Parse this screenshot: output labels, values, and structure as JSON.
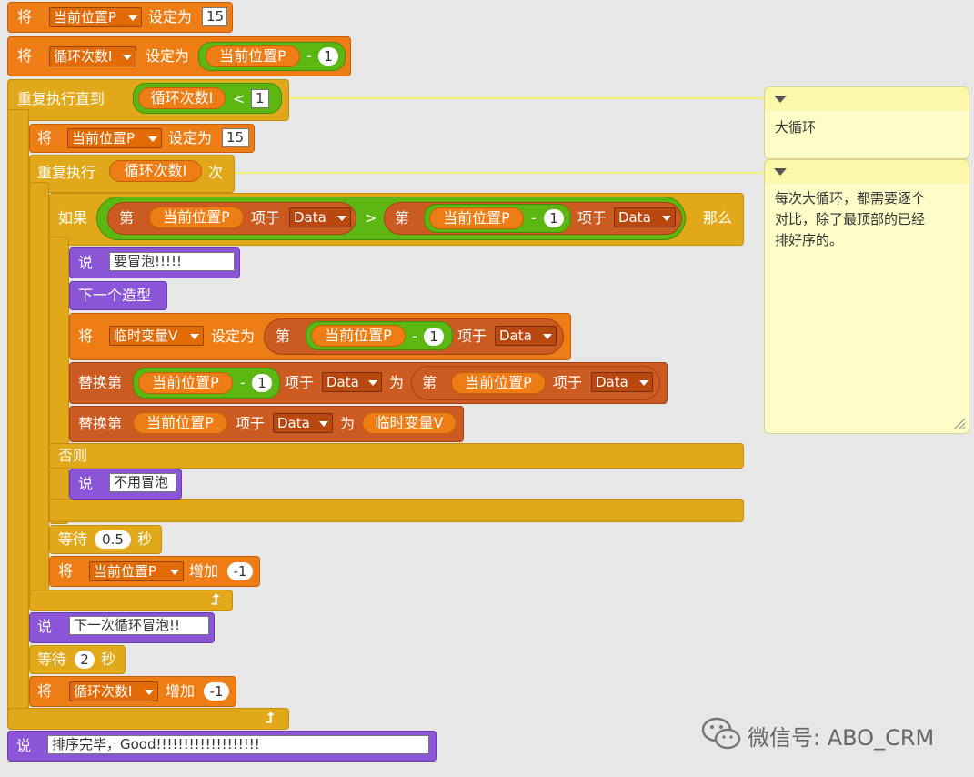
{
  "k": {
    "jiang": "将",
    "set_to": "设定为",
    "repeat_until": "重复执行直到",
    "repeat": "重复执行",
    "times": "次",
    "if": "如果",
    "else": "否则",
    "then": "那么",
    "say": "说",
    "next_costume": "下一个造型",
    "wait": "等待",
    "seconds": "秒",
    "change_by": "增加",
    "item": "第",
    "of": "项于",
    "replace_item": "替换第",
    "with": "为",
    "lt": "<",
    "gt": ">",
    "minus": "-"
  },
  "vars": {
    "pos": "当前位置P",
    "loop": "循环次数I",
    "temp": "临时变量V",
    "list": "Data"
  },
  "vals": {
    "set_pos": "15",
    "one": "1",
    "lt_val": "1",
    "inner_set_pos": "15",
    "wait1": "0.5",
    "change1": "-1",
    "wait2": "2",
    "change2": "-1"
  },
  "says": {
    "bubble": "要冒泡!!!!!",
    "no_bubble": "不用冒泡",
    "next_round": "下一次循环冒泡!!",
    "done": "排序完毕，Good!!!!!!!!!!!!!!!!!!!"
  },
  "notes": {
    "outer": "大循环",
    "inner_1": "每次大循环，都需要逐个",
    "inner_2": "对比，除了最顶部的已经",
    "inner_3": "排好序的。"
  },
  "watermark": "微信号: ABO_CRM",
  "colors": {
    "control": "#e1a91a",
    "data": "#ee7d16",
    "list": "#cc5b22",
    "looks": "#8a55d7",
    "operators": "#5cb712",
    "note": "#fefdc7"
  }
}
